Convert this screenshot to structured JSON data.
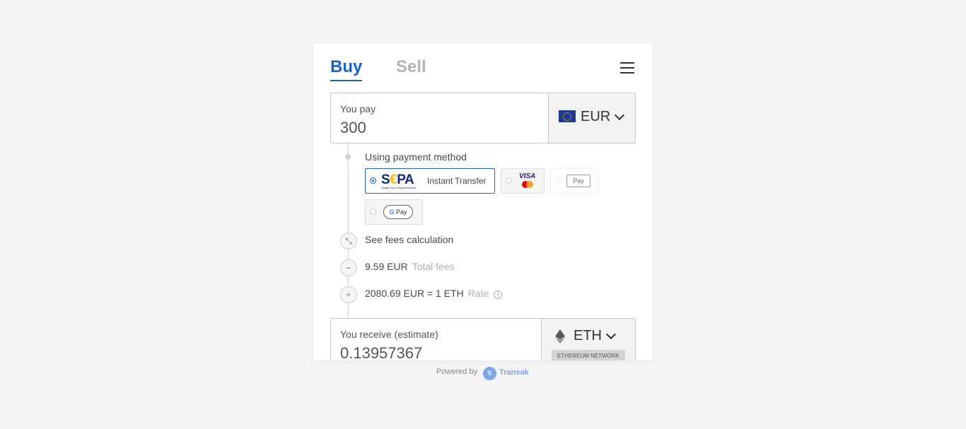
{
  "tabs": {
    "buy": "Buy",
    "sell": "Sell"
  },
  "pay": {
    "label": "You pay",
    "value": "300",
    "currency": "EUR"
  },
  "payment": {
    "heading": "Using payment method",
    "sepa_text": "Instant Transfer",
    "sepa_logo": "SEPA",
    "sepa_sub": "Single Euro Payments Area",
    "visa": "VISA",
    "apple": "Pay",
    "google_g": "G",
    "google_pay": "Pay"
  },
  "fees": {
    "link": "See fees calculation",
    "amount": "9.59 EUR",
    "amount_label": "Total fees",
    "rate": "2080.69 EUR = 1 ETH",
    "rate_label": "Rate"
  },
  "receive": {
    "label": "You receive (estimate)",
    "value": "0.13957367",
    "currency": "ETH",
    "network": "ETHEREUM NETWORK"
  },
  "footer": {
    "powered": "Powered by",
    "brand": "Transak"
  },
  "colors": {
    "accent": "#1a5fd4",
    "muted": "#b3b3b3",
    "sepa_blue": "#10298e",
    "brand": "#7da4e8"
  },
  "icons": [
    "menu-icon",
    "eu-flag-icon",
    "chevron-down-icon",
    "collapse-icon",
    "minus-icon",
    "divide-icon",
    "info-icon",
    "eth-icon",
    "transak-logo-icon"
  ]
}
